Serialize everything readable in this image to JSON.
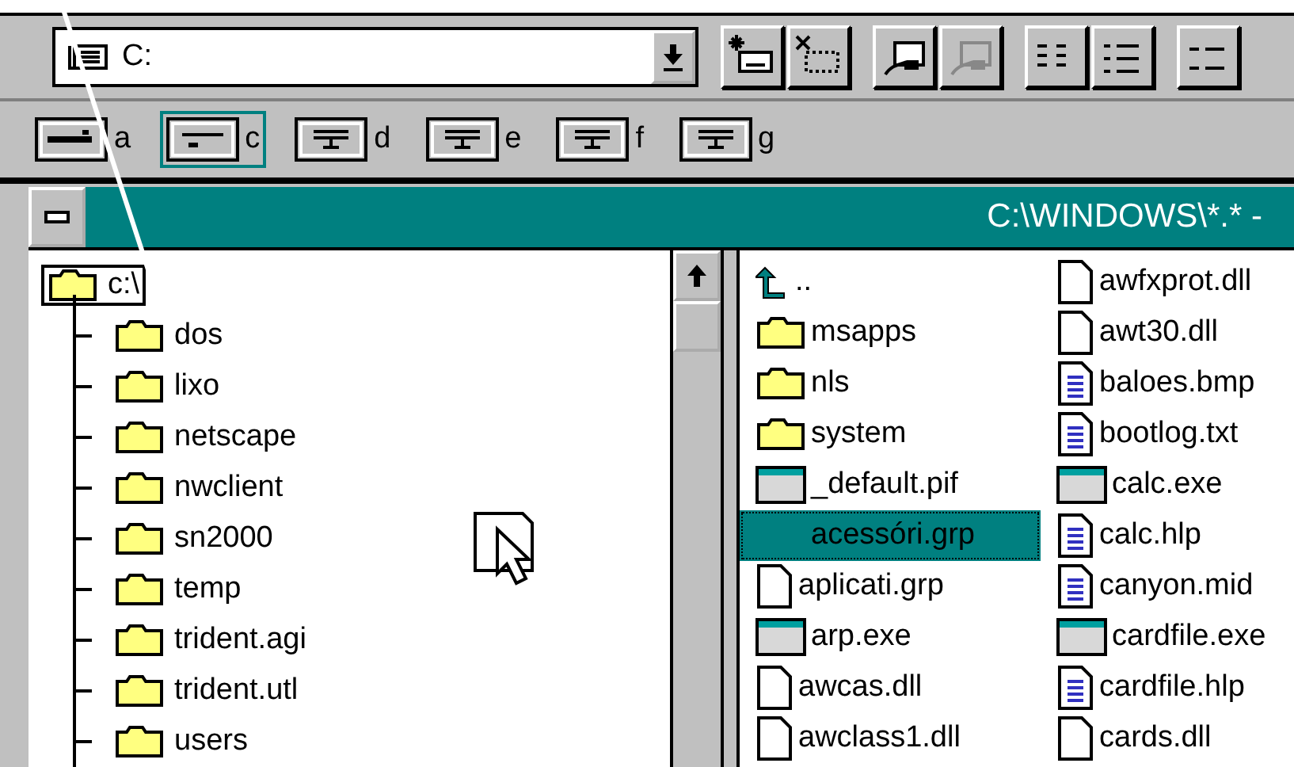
{
  "drive_combo": {
    "value": "C:"
  },
  "toolbar_buttons": [
    {
      "kind": "connect",
      "disabled": false
    },
    {
      "kind": "disconnect",
      "disabled": false
    },
    {
      "kind": "share",
      "disabled": false
    },
    {
      "kind": "share",
      "disabled": true
    },
    {
      "kind": "large",
      "disabled": false
    },
    {
      "kind": "list",
      "disabled": false
    },
    {
      "kind": "sort",
      "disabled": false
    }
  ],
  "drives": [
    {
      "letter": "a",
      "kind": "floppy",
      "selected": false
    },
    {
      "letter": "c",
      "kind": "hard",
      "selected": true
    },
    {
      "letter": "d",
      "kind": "network",
      "selected": false
    },
    {
      "letter": "e",
      "kind": "network",
      "selected": false
    },
    {
      "letter": "f",
      "kind": "network",
      "selected": false
    },
    {
      "letter": "g",
      "kind": "network",
      "selected": false
    }
  ],
  "window": {
    "title": "C:\\WINDOWS\\*.* -"
  },
  "tree": {
    "label": "c:\\",
    "selected": true,
    "children": [
      {
        "label": "dos",
        "selected": false
      },
      {
        "label": "lixo",
        "selected": false
      },
      {
        "label": "netscape",
        "selected": false
      },
      {
        "label": "nwclient",
        "selected": false
      },
      {
        "label": "sn2000",
        "selected": false
      },
      {
        "label": "temp",
        "selected": false
      },
      {
        "label": "trident.agi",
        "selected": false
      },
      {
        "label": "trident.utl",
        "selected": false
      },
      {
        "label": "users",
        "selected": false
      }
    ]
  },
  "files": [
    {
      "label": "..",
      "kind": "parent",
      "selected": false
    },
    {
      "label": "msapps",
      "kind": "folder",
      "selected": false
    },
    {
      "label": "nls",
      "kind": "folder",
      "selected": false
    },
    {
      "label": "system",
      "kind": "folder",
      "selected": false
    },
    {
      "label": "_default.pif",
      "kind": "program",
      "selected": false
    },
    {
      "label": "acessóri.grp",
      "kind": "blank",
      "selected": true
    },
    {
      "label": "aplicati.grp",
      "kind": "file",
      "selected": false
    },
    {
      "label": "arp.exe",
      "kind": "program",
      "selected": false
    },
    {
      "label": "awcas.dll",
      "kind": "file",
      "selected": false
    },
    {
      "label": "awclass1.dll",
      "kind": "file",
      "selected": false
    },
    {
      "label": "awfxprot.dll",
      "kind": "file",
      "selected": false
    },
    {
      "label": "awt30.dll",
      "kind": "file",
      "selected": false
    },
    {
      "label": "baloes.bmp",
      "kind": "document",
      "selected": false
    },
    {
      "label": "bootlog.txt",
      "kind": "document",
      "selected": false
    },
    {
      "label": "calc.exe",
      "kind": "program",
      "selected": false
    },
    {
      "label": "calc.hlp",
      "kind": "document",
      "selected": false
    },
    {
      "label": "canyon.mid",
      "kind": "document",
      "selected": false
    },
    {
      "label": "cardfile.exe",
      "kind": "program",
      "selected": false
    },
    {
      "label": "cardfile.hlp",
      "kind": "document",
      "selected": false
    },
    {
      "label": "cards.dll",
      "kind": "file",
      "selected": false
    }
  ]
}
